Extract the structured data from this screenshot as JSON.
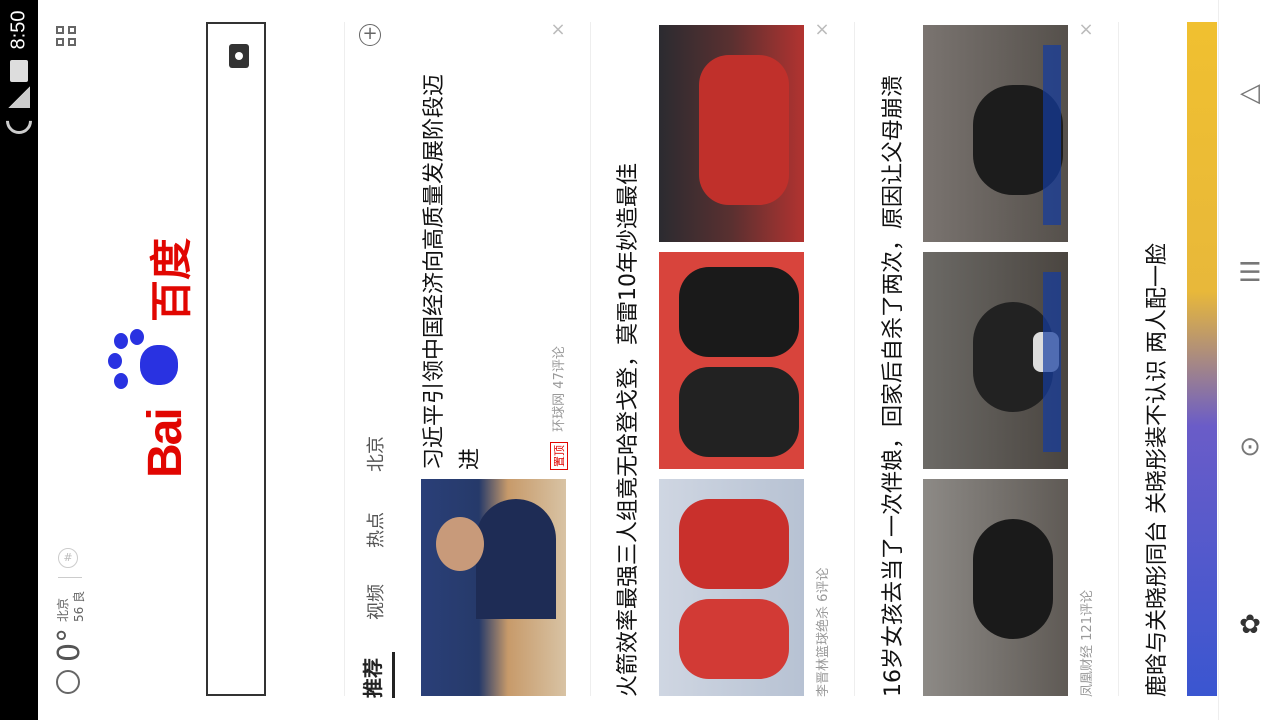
{
  "status_bar": {
    "time": "8:50"
  },
  "weather": {
    "temperature": "0°",
    "city": "北京",
    "aqi": "56 良"
  },
  "logo": {
    "bai": "Bai",
    "du": "百度"
  },
  "tabs": [
    {
      "label": "推荐",
      "active": true
    },
    {
      "label": "视频"
    },
    {
      "label": "热点"
    },
    {
      "label": "北京"
    }
  ],
  "feed": [
    {
      "title_line1": "习近平引领中国经济向高质量发展阶段迈",
      "title_line2": "进",
      "badge": "置顶",
      "source": "环球网",
      "comments": "47评论"
    },
    {
      "title": "火箭效率最强三人组竟无哈登戈登，莫雷10年妙造最佳",
      "source": "李晋林篮球绝杀",
      "comments": "6评论"
    },
    {
      "title": "16岁女孩去当了一次伴娘，回家后自杀了两次，原因让父母崩溃",
      "source": "凤凰财经",
      "comments": "121评论"
    },
    {
      "title": "鹿晗与关晓彤同台 关晓彤装不认识 两人配一脸"
    }
  ],
  "colors": {
    "brand_red": "#e10601",
    "brand_blue": "#2932e1"
  },
  "icons": {
    "grid": "grid-icon",
    "camera": "camera-icon",
    "add": "plus-circle-icon",
    "back": "back-icon",
    "menu": "bookmark-menu-icon",
    "home": "home-icon",
    "paw": "paw-icon",
    "close": "close-icon"
  }
}
